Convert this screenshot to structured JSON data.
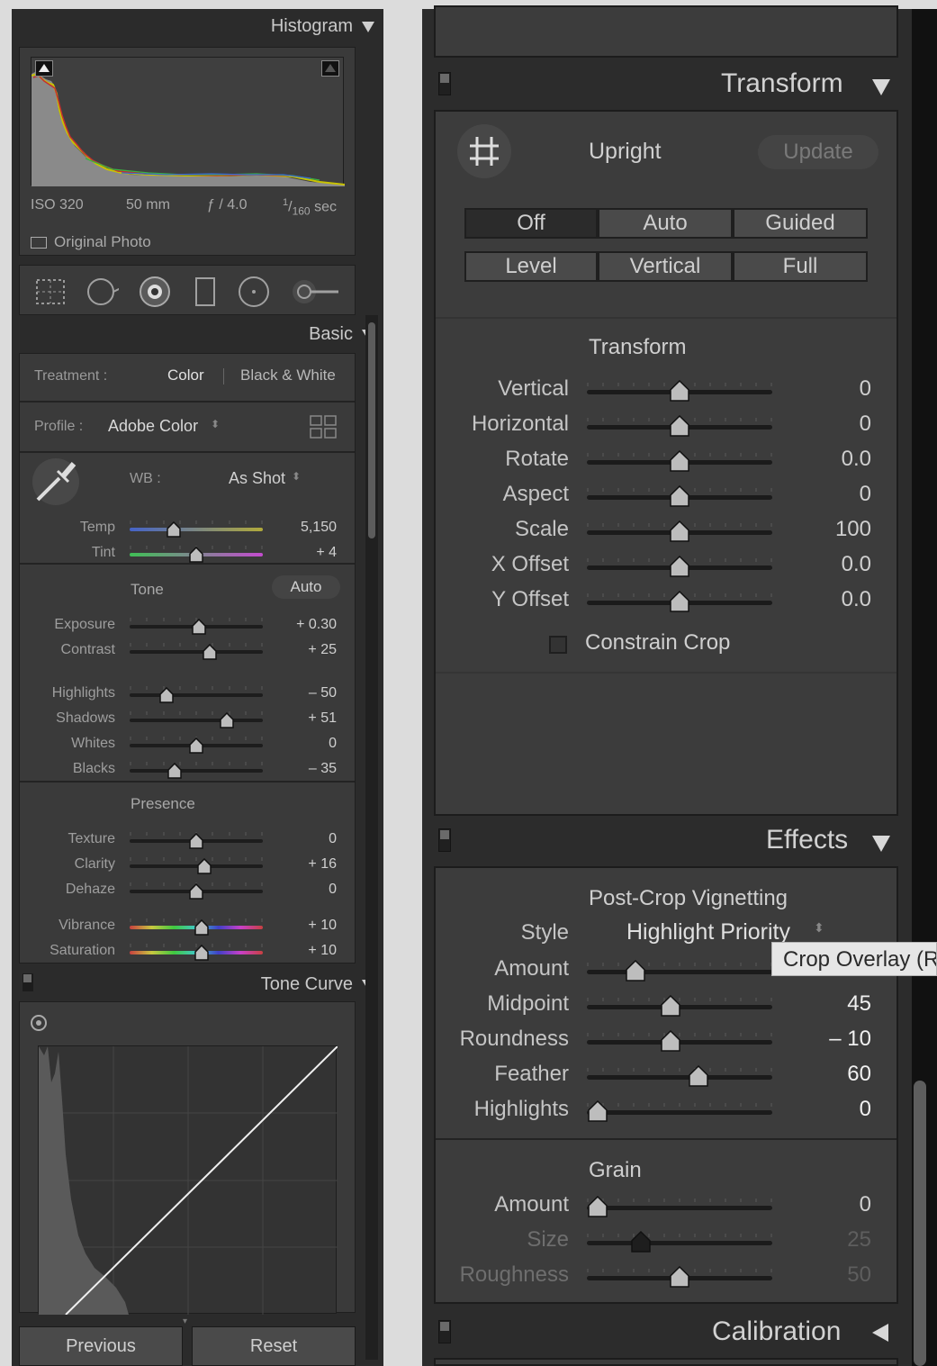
{
  "left": {
    "histogram": {
      "title": "Histogram",
      "iso": "ISO 320",
      "focal": "50 mm",
      "aperture": "ƒ / 4.0",
      "shutter_num": "1",
      "shutter_den": "160",
      "shutter_unit": "sec",
      "original_photo": "Original Photo"
    },
    "tools": [
      "crop-icon",
      "spot-removal-icon",
      "red-eye-icon",
      "graduated-filter-icon",
      "radial-filter-icon",
      "adjustment-brush-icon"
    ],
    "basic": {
      "title": "Basic",
      "treatment_label": "Treatment :",
      "treatment_color": "Color",
      "treatment_bw": "Black & White",
      "profile_label": "Profile :",
      "profile_value": "Adobe Color",
      "wb_label": "WB :",
      "wb_value": "As Shot",
      "temp": {
        "label": "Temp",
        "value": "5,150",
        "pos": 0.33
      },
      "tint": {
        "label": "Tint",
        "value": "+ 4",
        "pos": 0.5
      },
      "tone_title": "Tone",
      "auto": "Auto",
      "tone": [
        {
          "label": "Exposure",
          "value": "+ 0.30",
          "pos": 0.52
        },
        {
          "label": "Contrast",
          "value": "+ 25",
          "pos": 0.6
        }
      ],
      "tone2": [
        {
          "label": "Highlights",
          "value": "– 50",
          "pos": 0.28
        },
        {
          "label": "Shadows",
          "value": "+ 51",
          "pos": 0.73
        },
        {
          "label": "Whites",
          "value": "0",
          "pos": 0.5
        },
        {
          "label": "Blacks",
          "value": "– 35",
          "pos": 0.34
        }
      ],
      "presence_title": "Presence",
      "presence": [
        {
          "label": "Texture",
          "value": "0",
          "pos": 0.5
        },
        {
          "label": "Clarity",
          "value": "+ 16",
          "pos": 0.56
        },
        {
          "label": "Dehaze",
          "value": "0",
          "pos": 0.5
        }
      ],
      "presence2": [
        {
          "label": "Vibrance",
          "value": "+ 10",
          "pos": 0.54
        },
        {
          "label": "Saturation",
          "value": "+ 10",
          "pos": 0.54
        }
      ]
    },
    "tone_curve": {
      "title": "Tone Curve"
    },
    "buttons": {
      "previous": "Previous",
      "reset": "Reset"
    }
  },
  "right": {
    "transform": {
      "title": "Transform",
      "upright": "Upright",
      "update": "Update",
      "row1": [
        "Off",
        "Auto",
        "Guided"
      ],
      "row2": [
        "Level",
        "Vertical",
        "Full"
      ],
      "sub_title": "Transform",
      "sliders": [
        {
          "label": "Vertical",
          "value": "0",
          "pos": 0.5
        },
        {
          "label": "Horizontal",
          "value": "0",
          "pos": 0.5
        },
        {
          "label": "Rotate",
          "value": "0.0",
          "pos": 0.5
        },
        {
          "label": "Aspect",
          "value": "0",
          "pos": 0.5
        },
        {
          "label": "Scale",
          "value": "100",
          "pos": 0.5
        },
        {
          "label": "X Offset",
          "value": "0.0",
          "pos": 0.5
        },
        {
          "label": "Y Offset",
          "value": "0.0",
          "pos": 0.5
        }
      ],
      "constrain_crop": "Constrain Crop"
    },
    "effects": {
      "title": "Effects",
      "vignette_title": "Post-Crop Vignetting",
      "style_label": "Style",
      "style_value": "Highlight Priority",
      "amount": {
        "label": "Amount",
        "pos": 0.26
      },
      "vig": [
        {
          "label": "Midpoint",
          "value": "45",
          "pos": 0.45
        },
        {
          "label": "Roundness",
          "value": "– 10",
          "pos": 0.45
        },
        {
          "label": "Feather",
          "value": "60",
          "pos": 0.6
        },
        {
          "label": "Highlights",
          "value": "0",
          "pos": 0.06
        }
      ],
      "tooltip": "Crop Overlay (R)",
      "grain_title": "Grain",
      "grain": [
        {
          "label": "Amount",
          "value": "0",
          "pos": 0.06,
          "dim": false
        },
        {
          "label": "Size",
          "value": "25",
          "pos": 0.29,
          "dim": true
        },
        {
          "label": "Roughness",
          "value": "50",
          "pos": 0.5,
          "dim": true
        }
      ]
    },
    "calibration": {
      "title": "Calibration"
    }
  }
}
